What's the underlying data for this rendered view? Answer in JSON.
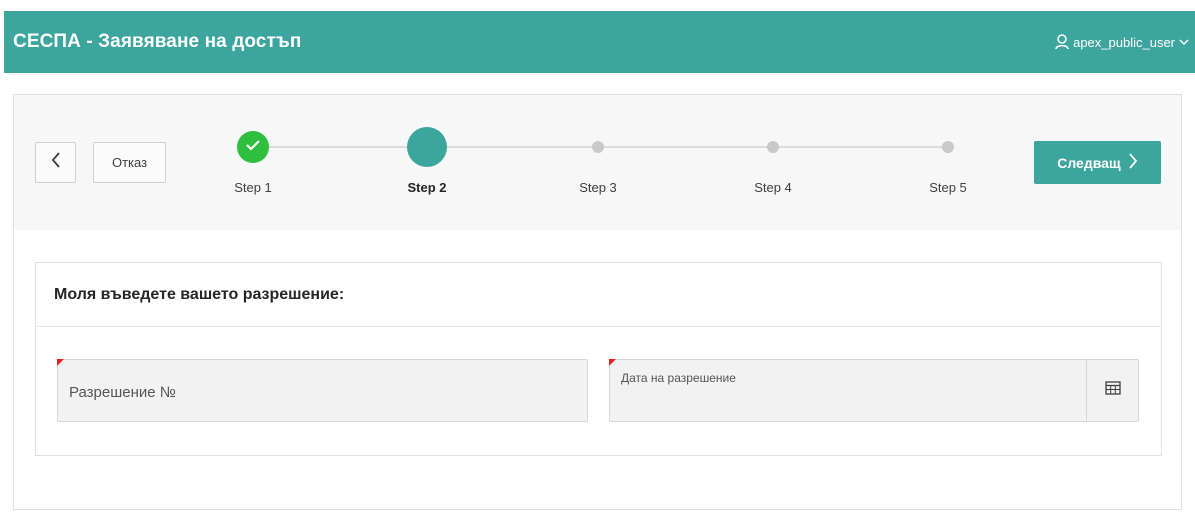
{
  "header": {
    "title": "СЕСПА - Заявяване на достъп",
    "user_name": "apex_public_user"
  },
  "wizard": {
    "cancel_label": "Отказ",
    "next_label": "Следващ",
    "steps": [
      {
        "label": "Step 1",
        "status": "complete"
      },
      {
        "label": "Step 2",
        "status": "current"
      },
      {
        "label": "Step 3",
        "status": "upcoming"
      },
      {
        "label": "Step 4",
        "status": "upcoming"
      },
      {
        "label": "Step 5",
        "status": "upcoming"
      }
    ]
  },
  "region": {
    "title": "Моля въведете вашето разрешение:",
    "permit_field": {
      "label": "Разрешение №",
      "value": "",
      "required": true
    },
    "date_field": {
      "label": "Дата на разрешение",
      "value": "",
      "required": true
    }
  },
  "colors": {
    "accent": "#3ba59e",
    "complete": "#2ebf3e",
    "required": "#e8201e"
  },
  "icons": {
    "user": "user-icon",
    "user_menu": "chevron-down-icon",
    "back": "chevron-left-icon",
    "next": "chevron-right-icon",
    "complete": "check-icon",
    "calendar": "calendar-icon"
  }
}
